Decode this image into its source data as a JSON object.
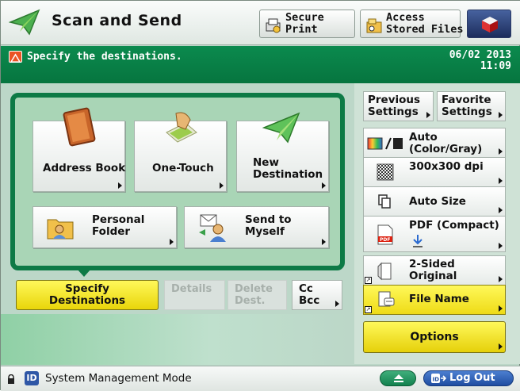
{
  "header": {
    "title": "Scan and Send",
    "secure_print": "Secure\nPrint",
    "access_stored_files": "Access\nStored Files"
  },
  "message_bar": {
    "message": "Specify the destinations.",
    "date": "06/02 2013",
    "time": "11:09"
  },
  "destinations": {
    "address_book": "Address Book",
    "one_touch": "One-Touch",
    "new_destination": "New\nDestination",
    "personal_folder": "Personal\nFolder",
    "send_to_myself": "Send to\nMyself"
  },
  "bottom_row": {
    "specify": "Specify\nDestinations",
    "details": "Details",
    "delete": "Delete\nDest.",
    "cc_bcc": "Cc\nBcc"
  },
  "right_panel": {
    "previous_settings": "Previous\nSettings",
    "favorite_settings": "Favorite\nSettings",
    "color_mode": "Auto\n(Color/Gray)",
    "resolution": "300x300 dpi",
    "scan_size": "Auto Size",
    "file_format": "PDF (Compact)",
    "sided": "2-Sided\nOriginal",
    "file_name": "File Name",
    "options": "Options"
  },
  "status_bar": {
    "mode": "System Management Mode",
    "id_badge": "ID",
    "logout": "Log Out"
  },
  "colors": {
    "header_green": "#0b8a4e",
    "panel_border": "#0d7a46",
    "yellow_button": "#fff85a",
    "logout_blue": "#1f4da1"
  }
}
